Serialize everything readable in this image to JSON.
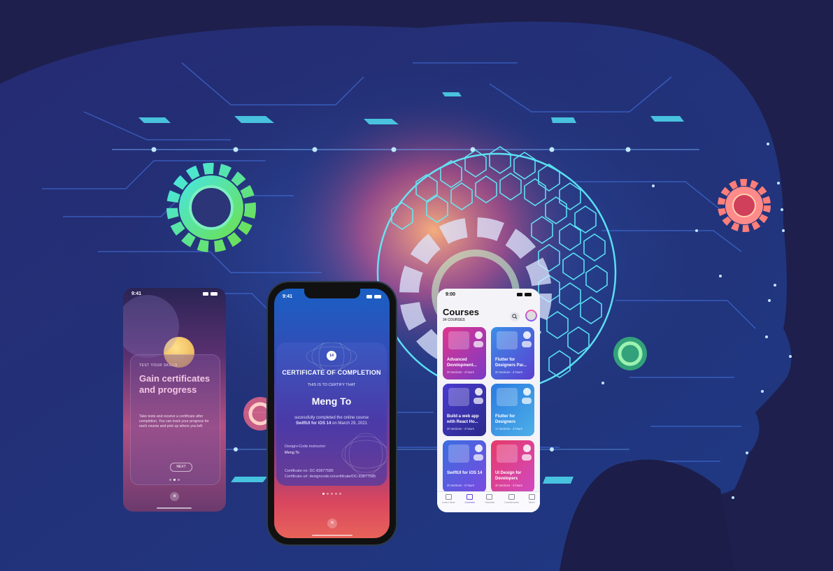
{
  "onboarding": {
    "time": "9:41",
    "kicker": "TEST YOUR SKILLS",
    "title": "Gain certificates and progress",
    "body": "Take tests and receive a certificate after completion. You can track your progress for each course and pick up where you left.",
    "next_label": "NEXT",
    "close_icon": "close-icon",
    "close_glyph": "✕"
  },
  "certificate": {
    "time": "9:41",
    "badge": "14",
    "title": "CERTIFICATE OF COMPLETION",
    "subtitle": "THIS IS TO CERTIFY THAT",
    "name": "Meng To",
    "text_prefix": "sucessfully completed the online course ",
    "course": "SwiftUI for iOS 14",
    "text_suffix": " on March 29, 2021",
    "instructor_label": "Design+Code instructor:",
    "instructor_value": "Meng To",
    "cert_no": "Certificate no: DC-83877585",
    "cert_url": "Certificate url: designcode.io/certificate/DC-83877585",
    "close_glyph": "✕"
  },
  "courses": {
    "time": "9:00",
    "title": "Courses",
    "count": "34 COURSES",
    "items": [
      {
        "title": "Advanced Development...",
        "meta": "20 sections - 4 hours",
        "color1": "#e0358f",
        "color2": "#7a3ac6"
      },
      {
        "title": "Flutter for Designers Par...",
        "meta": "20 sections - 4 hours",
        "color1": "#3b8ee8",
        "color2": "#5b3fd0"
      },
      {
        "title": "Build a web app with React Ho...",
        "meta": "20 sections - 4 hours",
        "color1": "#4a3ad0",
        "color2": "#2a2a8a"
      },
      {
        "title": "Flutter for Designers",
        "meta": "17 sections - 4 hours",
        "color1": "#2a7ae0",
        "color2": "#4db0e8"
      },
      {
        "title": "SwiftUI for iOS 14",
        "meta": "20 sections - 3 hours",
        "color1": "#3a6ee0",
        "color2": "#7a4ae0"
      },
      {
        "title": "UI Design for Developers",
        "meta": "20 sections - 4 hours",
        "color1": "#e63a6a",
        "color2": "#d04ac0"
      }
    ],
    "tabs": [
      {
        "label": "Learn Now",
        "active": false
      },
      {
        "label": "Courses",
        "active": true
      },
      {
        "label": "Tutorials",
        "active": false
      },
      {
        "label": "Livestreams",
        "active": false
      },
      {
        "label": "More",
        "active": false
      }
    ]
  },
  "colors": {
    "background": "#1e1f4d",
    "circuit": "#3a78e6",
    "glow_cyan": "#5ff2ff",
    "gear_green": "#3ce08a",
    "gear_pink": "#ff6e7a"
  }
}
